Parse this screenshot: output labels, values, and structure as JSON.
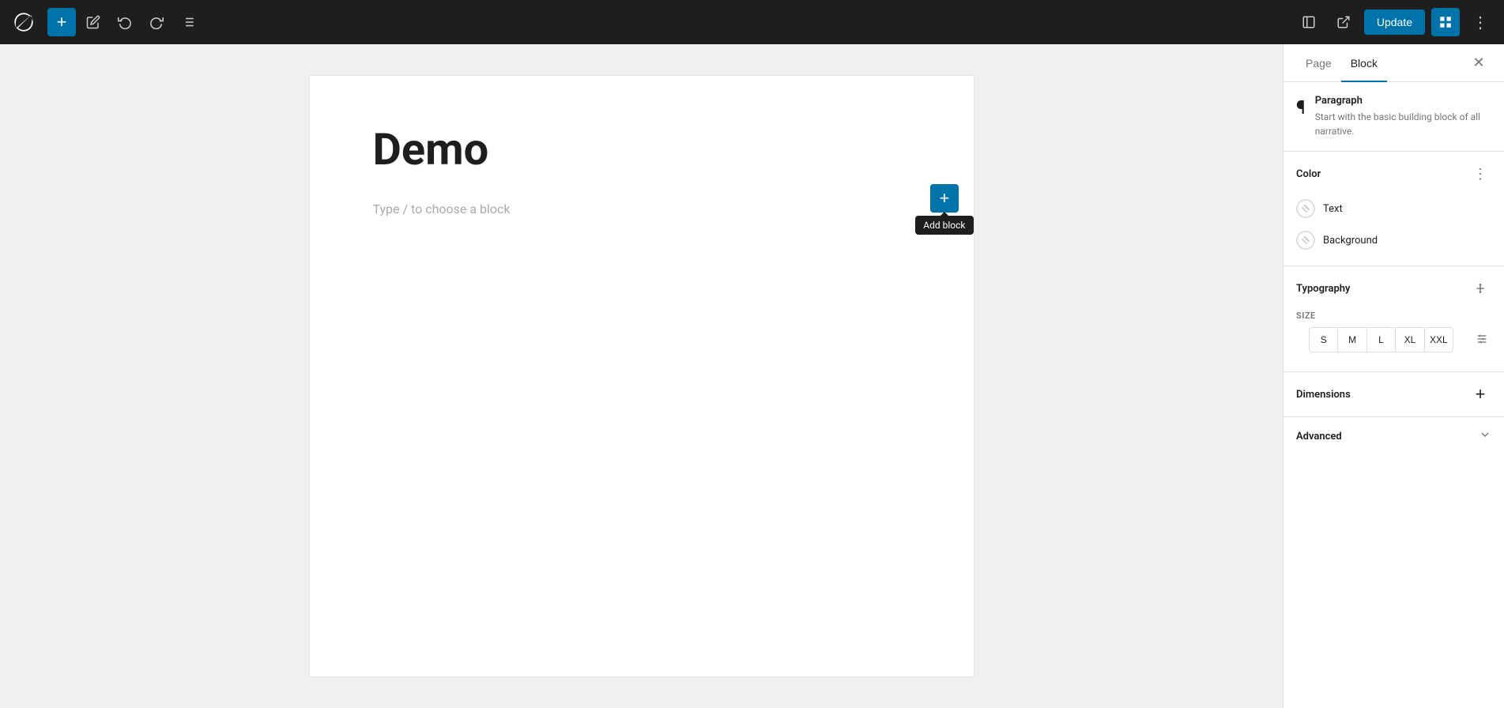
{
  "toolbar": {
    "add_label": "+",
    "undo_label": "↩",
    "redo_label": "↪",
    "list_label": "≡",
    "update_label": "Update",
    "view_label": "⧉",
    "settings_label": "▣",
    "more_label": "⋮"
  },
  "editor": {
    "title": "Demo",
    "placeholder": "Type / to choose a block",
    "add_block_tooltip": "Add block"
  },
  "sidebar": {
    "tab_page": "Page",
    "tab_block": "Block",
    "close_label": "✕",
    "paragraph": {
      "title": "Paragraph",
      "description": "Start with the basic building block of all narrative."
    },
    "color": {
      "section_title": "Color",
      "more_icon": "⋮",
      "items": [
        {
          "label": "Text"
        },
        {
          "label": "Background"
        }
      ]
    },
    "typography": {
      "section_title": "Typography",
      "more_icon": "⋮",
      "size_label": "SIZE",
      "sizes": [
        "S",
        "M",
        "L",
        "XL",
        "XXL"
      ],
      "tools_icon": "⇅"
    },
    "dimensions": {
      "section_title": "Dimensions",
      "add_icon": "+"
    },
    "advanced": {
      "section_title": "Advanced",
      "chevron_icon": "▾"
    }
  }
}
